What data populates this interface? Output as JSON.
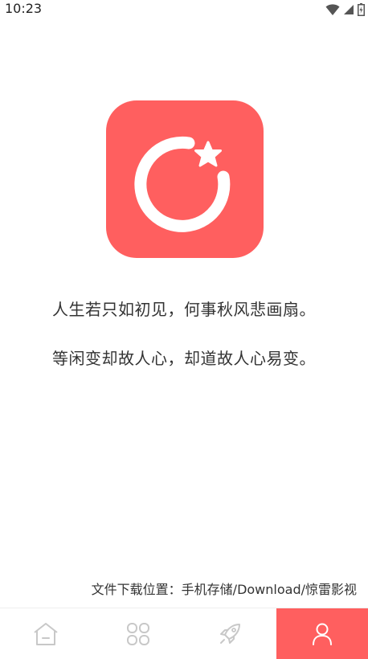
{
  "status_bar": {
    "time": "10:23",
    "icons": [
      "wifi-icon",
      "signal-icon",
      "battery-icon"
    ]
  },
  "logo": {
    "icon": "moon-star-logo-icon",
    "background_color": "#ff5f5f"
  },
  "quotes": {
    "line1": "人生若只如初见，何事秋风悲画扇。",
    "line2": "等闲变却故人心，却道故人心易变。"
  },
  "download": {
    "path_text": "文件下载位置：手机存储/Download/惊雷影视"
  },
  "bottom_nav": {
    "active_color": "#ff5f5f",
    "items": [
      {
        "icon": "home-icon",
        "active": false
      },
      {
        "icon": "grid-icon",
        "active": false
      },
      {
        "icon": "rocket-icon",
        "active": false
      },
      {
        "icon": "user-icon",
        "active": true
      }
    ]
  }
}
